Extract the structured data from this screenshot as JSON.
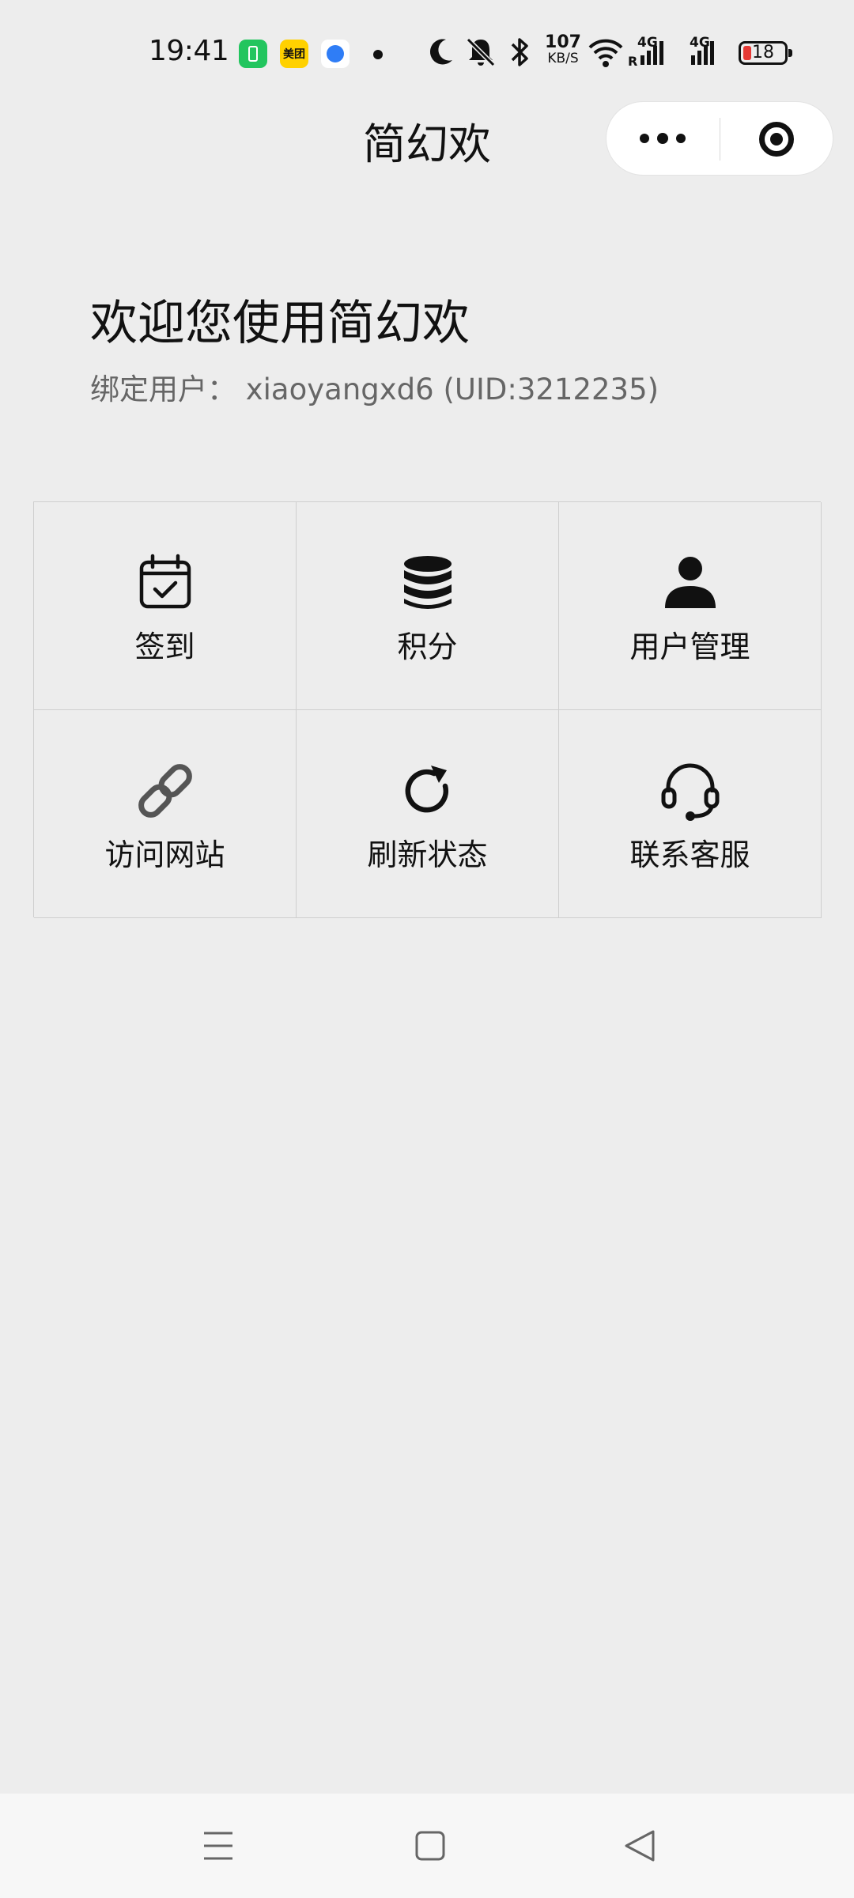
{
  "status_bar": {
    "time": "19:41",
    "notification_icons": [
      "charging-app-icon",
      "meituan-app-icon",
      "browser-app-icon"
    ],
    "meituan_label": "美团",
    "net_speed": "107",
    "net_speed_unit": "KB/S",
    "network_type_1": "4G",
    "network_type_2": "4G",
    "roaming": "R",
    "battery_level": "18",
    "battery_color": "#e53935"
  },
  "header": {
    "title": "简幻欢",
    "more_icon": "more-dots-icon",
    "close_icon": "target-close-icon"
  },
  "welcome": {
    "title": "欢迎您使用简幻欢",
    "bound_user": "绑定用户：  xiaoyangxd6 (UID:3212235)"
  },
  "grid": {
    "items": [
      {
        "label": "签到",
        "icon": "calendar-check-icon"
      },
      {
        "label": "积分",
        "icon": "database-coins-icon"
      },
      {
        "label": "用户管理",
        "icon": "user-icon"
      },
      {
        "label": "访问网站",
        "icon": "link-icon"
      },
      {
        "label": "刷新状态",
        "icon": "refresh-icon"
      },
      {
        "label": "联系客服",
        "icon": "headset-icon"
      }
    ]
  },
  "nav_bar": {
    "buttons": [
      "menu-icon",
      "home-square-icon",
      "back-triangle-icon"
    ]
  }
}
